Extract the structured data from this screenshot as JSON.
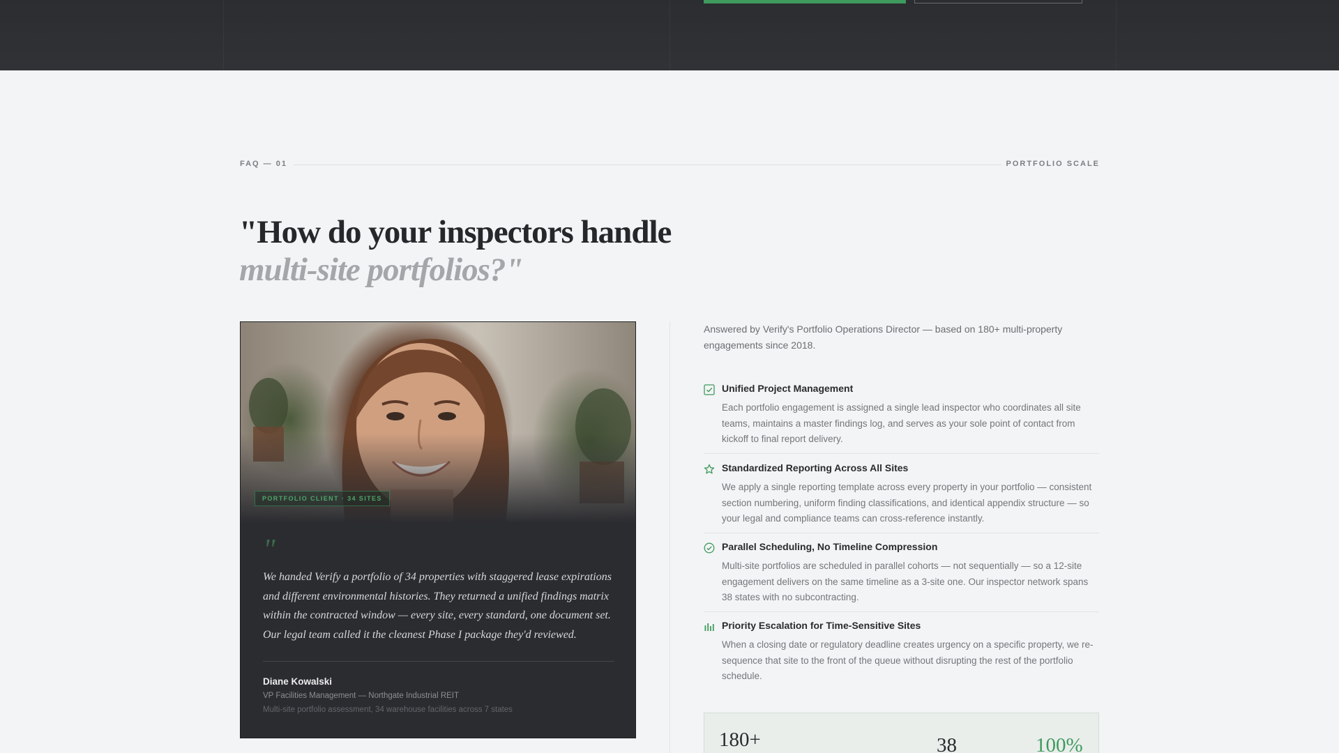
{
  "section": {
    "label_left": "FAQ — 01",
    "label_right": "PORTFOLIO SCALE"
  },
  "headline": {
    "line1": "\"How do your inspectors handle",
    "line2": "multi-site portfolios?\""
  },
  "testimonial": {
    "client_tag": "PORTFOLIO CLIENT · 34 SITES",
    "quote_mark": "\"",
    "quote": "We handed Verify a portfolio of 34 properties with staggered lease expirations and different environmental histories. They returned a unified findings matrix within the contracted window — every site, every standard, one document set. Our legal team called it the cleanest Phase I package they'd reviewed.",
    "author_name": "Diane Kowalski",
    "author_role": "VP Facilities Management — Northgate Industrial REIT",
    "author_project": "Multi-site portfolio assessment, 34 warehouse facilities across 7 states"
  },
  "answer": {
    "answered_by": "Answered by Verify's Portfolio Operations Director — based on 180+ multi-property engagements since 2018.",
    "features": [
      {
        "icon": "checkbox-icon",
        "title": "Unified Project Management",
        "desc": "Each portfolio engagement is assigned a single lead inspector who coordinates all site teams, maintains a master findings log, and serves as your sole point of contact from kickoff to final report delivery."
      },
      {
        "icon": "star-icon",
        "title": "Standardized Reporting Across All Sites",
        "desc": "We apply a single reporting template across every property in your portfolio — consistent section numbering, uniform finding classifications, and identical appendix structure — so your legal and compliance teams can cross-reference instantly."
      },
      {
        "icon": "check-circle-icon",
        "title": "Parallel Scheduling, No Timeline Compression",
        "desc": "Multi-site portfolios are scheduled in parallel cohorts — not sequentially — so a 12-site engagement delivers on the same timeline as a 3-site one. Our inspector network spans 38 states with no subcontracting."
      },
      {
        "icon": "bar-chart-icon",
        "title": "Priority Escalation for Time-Sensitive Sites",
        "desc": "When a closing date or regulatory deadline creates urgency on a specific property, we re-sequence that site to the front of the queue without disrupting the rest of the portfolio schedule."
      }
    ]
  },
  "stats": {
    "stat1": "180+",
    "stat2": "38",
    "stat3": "100%"
  },
  "colors": {
    "accent": "#3f9a5e",
    "dark": "#2b2c30",
    "background": "#f3f4f5"
  }
}
